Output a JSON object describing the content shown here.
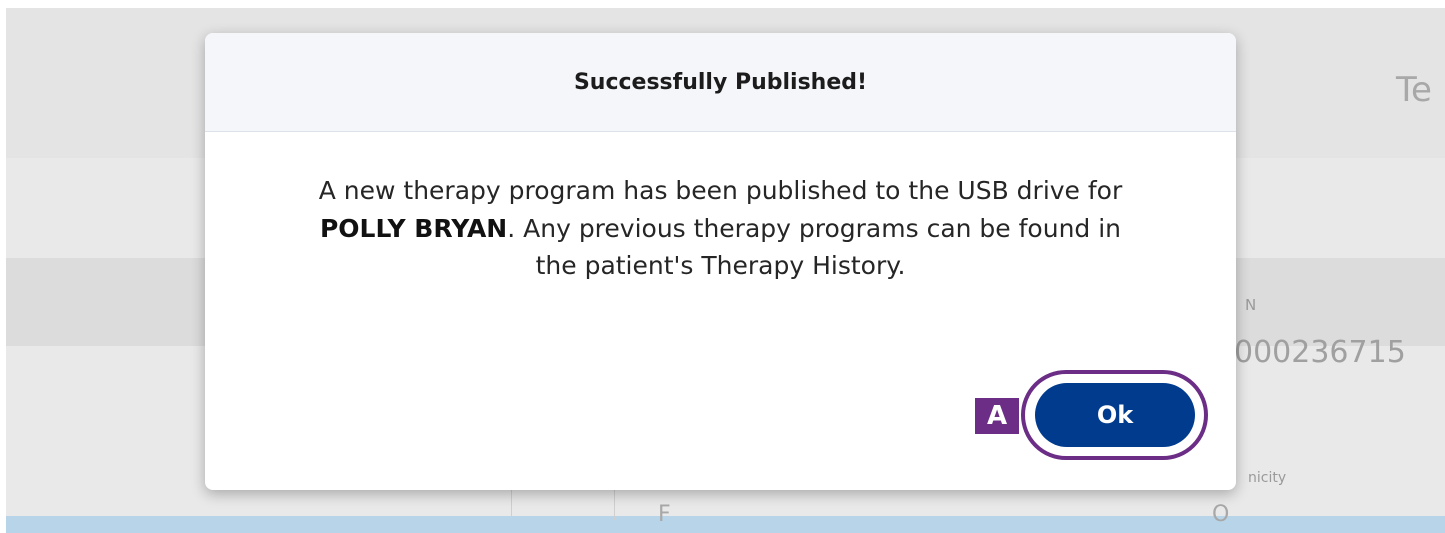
{
  "background": {
    "partial_title": "Te",
    "field_label_fragment": "N",
    "id_fragment": "000236715",
    "ethnicity_fragment": "nicity",
    "value_fragment_1": "F",
    "value_fragment_2": "O"
  },
  "dialog": {
    "title": "Successfully Published!",
    "message_line1": "A new therapy program has been published to the USB drive for",
    "patient_name": "POLLY BRYAN",
    "message_line2_rest": ". Any previous therapy programs can be found in",
    "message_line3": "the patient's Therapy History.",
    "ok_label": "Ok"
  },
  "annotation": {
    "callout_label": "A",
    "color": "#6b2d86"
  },
  "colors": {
    "button_primary": "#003b8e",
    "header_bg": "#f4f6fa",
    "highlight_band": "#b7d4e8"
  }
}
